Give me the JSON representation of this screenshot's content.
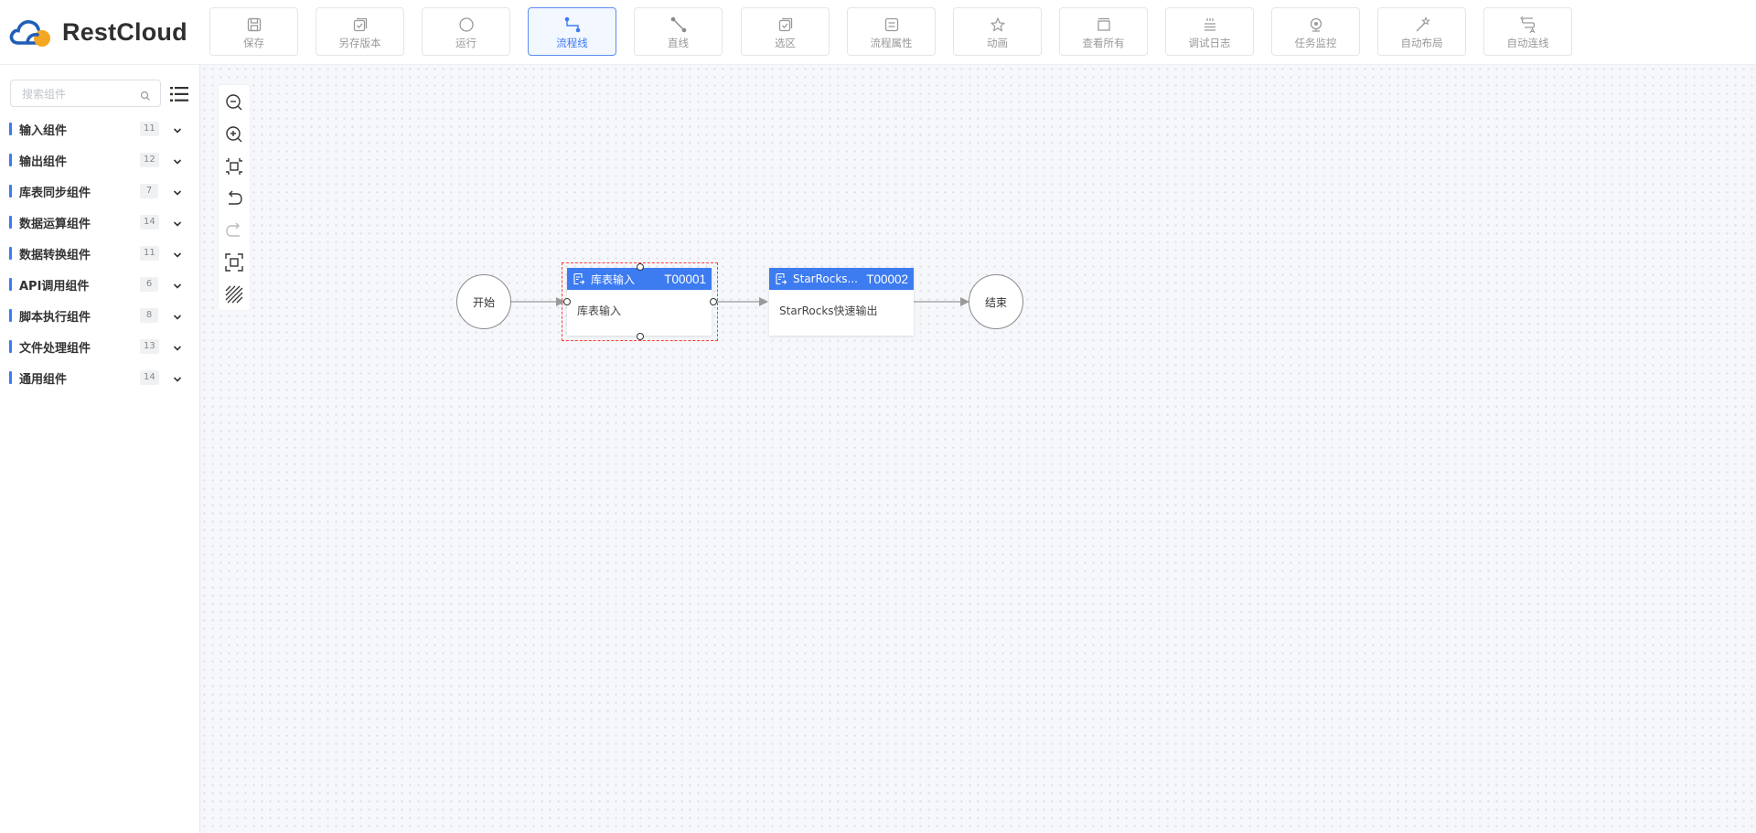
{
  "app": {
    "logo_text": "RestCloud"
  },
  "toolbar": [
    {
      "key": "save",
      "label": "保存",
      "icon": "save-icon"
    },
    {
      "key": "save-version",
      "label": "另存版本",
      "icon": "save-version-icon"
    },
    {
      "key": "run",
      "label": "运行",
      "icon": "run-icon"
    },
    {
      "key": "flow-line",
      "label": "流程线",
      "icon": "flow-line-icon",
      "active": true
    },
    {
      "key": "straight-line",
      "label": "直线",
      "icon": "straight-line-icon"
    },
    {
      "key": "select-area",
      "label": "选区",
      "icon": "select-area-icon"
    },
    {
      "key": "flow-props",
      "label": "流程属性",
      "icon": "flow-properties-icon"
    },
    {
      "key": "animation",
      "label": "动画",
      "icon": "star-icon"
    },
    {
      "key": "view-all",
      "label": "查看所有",
      "icon": "view-all-icon"
    },
    {
      "key": "debug-log",
      "label": "调试日志",
      "icon": "log-icon"
    },
    {
      "key": "task-monitor",
      "label": "任务监控",
      "icon": "monitor-icon"
    },
    {
      "key": "auto-layout",
      "label": "自动布局",
      "icon": "magic-wand-icon"
    },
    {
      "key": "auto-connect",
      "label": "自动连线",
      "icon": "auto-connect-icon"
    }
  ],
  "sidebar": {
    "search_placeholder": "搜索组件",
    "categories": [
      {
        "name": "输入组件",
        "count": "11"
      },
      {
        "name": "输出组件",
        "count": "12"
      },
      {
        "name": "库表同步组件",
        "count": "7"
      },
      {
        "name": "数据运算组件",
        "count": "14"
      },
      {
        "name": "数据转换组件",
        "count": "11"
      },
      {
        "name": "API调用组件",
        "count": "6"
      },
      {
        "name": "脚本执行组件",
        "count": "8"
      },
      {
        "name": "文件处理组件",
        "count": "13"
      },
      {
        "name": "通用组件",
        "count": "14"
      }
    ]
  },
  "canvas": {
    "start_label": "开始",
    "end_label": "结束",
    "tasks": [
      {
        "title": "库表输入",
        "id": "T00001",
        "body": "库表输入",
        "selected": true
      },
      {
        "title": "StarRocks...",
        "id": "T00002",
        "body": "StarRocks快速输出",
        "selected": false
      }
    ]
  },
  "colors": {
    "accent": "#3d7bf0",
    "selection": "#ff3d3d",
    "canvas_bg": "#f5f7fb"
  }
}
